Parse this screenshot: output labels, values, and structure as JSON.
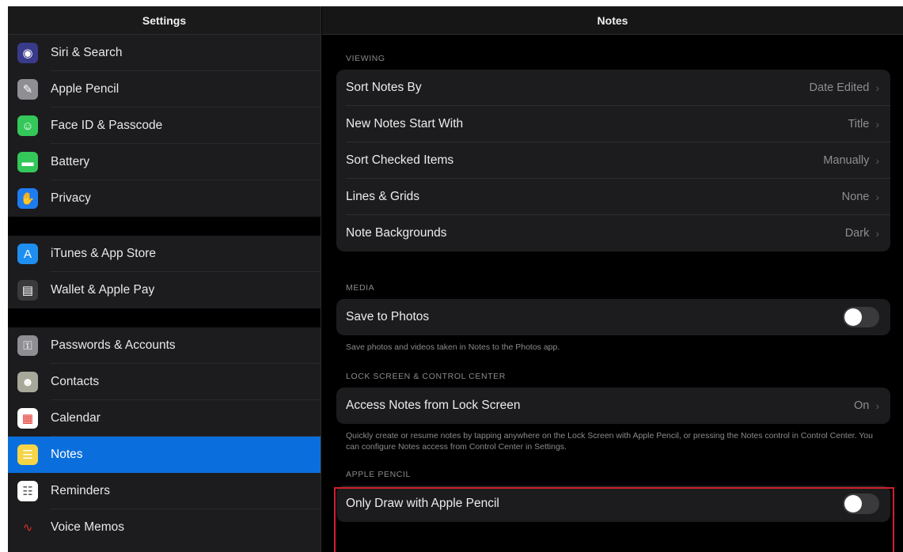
{
  "sidebar": {
    "title": "Settings",
    "groups": [
      [
        {
          "label": "Siri & Search",
          "icon": "siri-icon",
          "color": "#3a3a8a"
        },
        {
          "label": "Apple Pencil",
          "icon": "pencil-icon",
          "color": "#8e8e93"
        },
        {
          "label": "Face ID & Passcode",
          "icon": "face-id-icon",
          "color": "#34c759"
        },
        {
          "label": "Battery",
          "icon": "battery-icon",
          "color": "#34c759"
        },
        {
          "label": "Privacy",
          "icon": "hand-icon",
          "color": "#1e7cf0"
        }
      ],
      [
        {
          "label": "iTunes & App Store",
          "icon": "app-store-icon",
          "color": "#1e8ff0"
        },
        {
          "label": "Wallet & Apple Pay",
          "icon": "wallet-icon",
          "color": "#3a3a3c"
        }
      ],
      [
        {
          "label": "Passwords & Accounts",
          "icon": "key-icon",
          "color": "#8e8e93"
        },
        {
          "label": "Contacts",
          "icon": "contacts-icon",
          "color": "#a8a89a"
        },
        {
          "label": "Calendar",
          "icon": "calendar-icon",
          "color": "#ffffff"
        },
        {
          "label": "Notes",
          "icon": "notes-icon",
          "color": "#f5d547",
          "selected": true
        },
        {
          "label": "Reminders",
          "icon": "reminders-icon",
          "color": "#ffffff"
        },
        {
          "label": "Voice Memos",
          "icon": "voice-memos-icon",
          "color": "#1c1c1e"
        }
      ]
    ]
  },
  "detail": {
    "title": "Notes",
    "viewing": {
      "header": "VIEWING",
      "rows": [
        {
          "label": "Sort Notes By",
          "value": "Date Edited"
        },
        {
          "label": "New Notes Start With",
          "value": "Title"
        },
        {
          "label": "Sort Checked Items",
          "value": "Manually"
        },
        {
          "label": "Lines & Grids",
          "value": "None"
        },
        {
          "label": "Note Backgrounds",
          "value": "Dark"
        }
      ]
    },
    "media": {
      "header": "MEDIA",
      "save_label": "Save to Photos",
      "save_on": false,
      "footer": "Save photos and videos taken in Notes to the Photos app."
    },
    "lock": {
      "header": "LOCK SCREEN & CONTROL CENTER",
      "row_label": "Access Notes from Lock Screen",
      "row_value": "On",
      "footer": "Quickly create or resume notes by tapping anywhere on the Lock Screen with Apple Pencil, or pressing the Notes control in Control Center. You can configure Notes access from Control Center in Settings."
    },
    "pencil": {
      "header": "APPLE PENCIL",
      "row_label": "Only Draw with Apple Pencil",
      "on": false
    }
  },
  "chevron": "›"
}
